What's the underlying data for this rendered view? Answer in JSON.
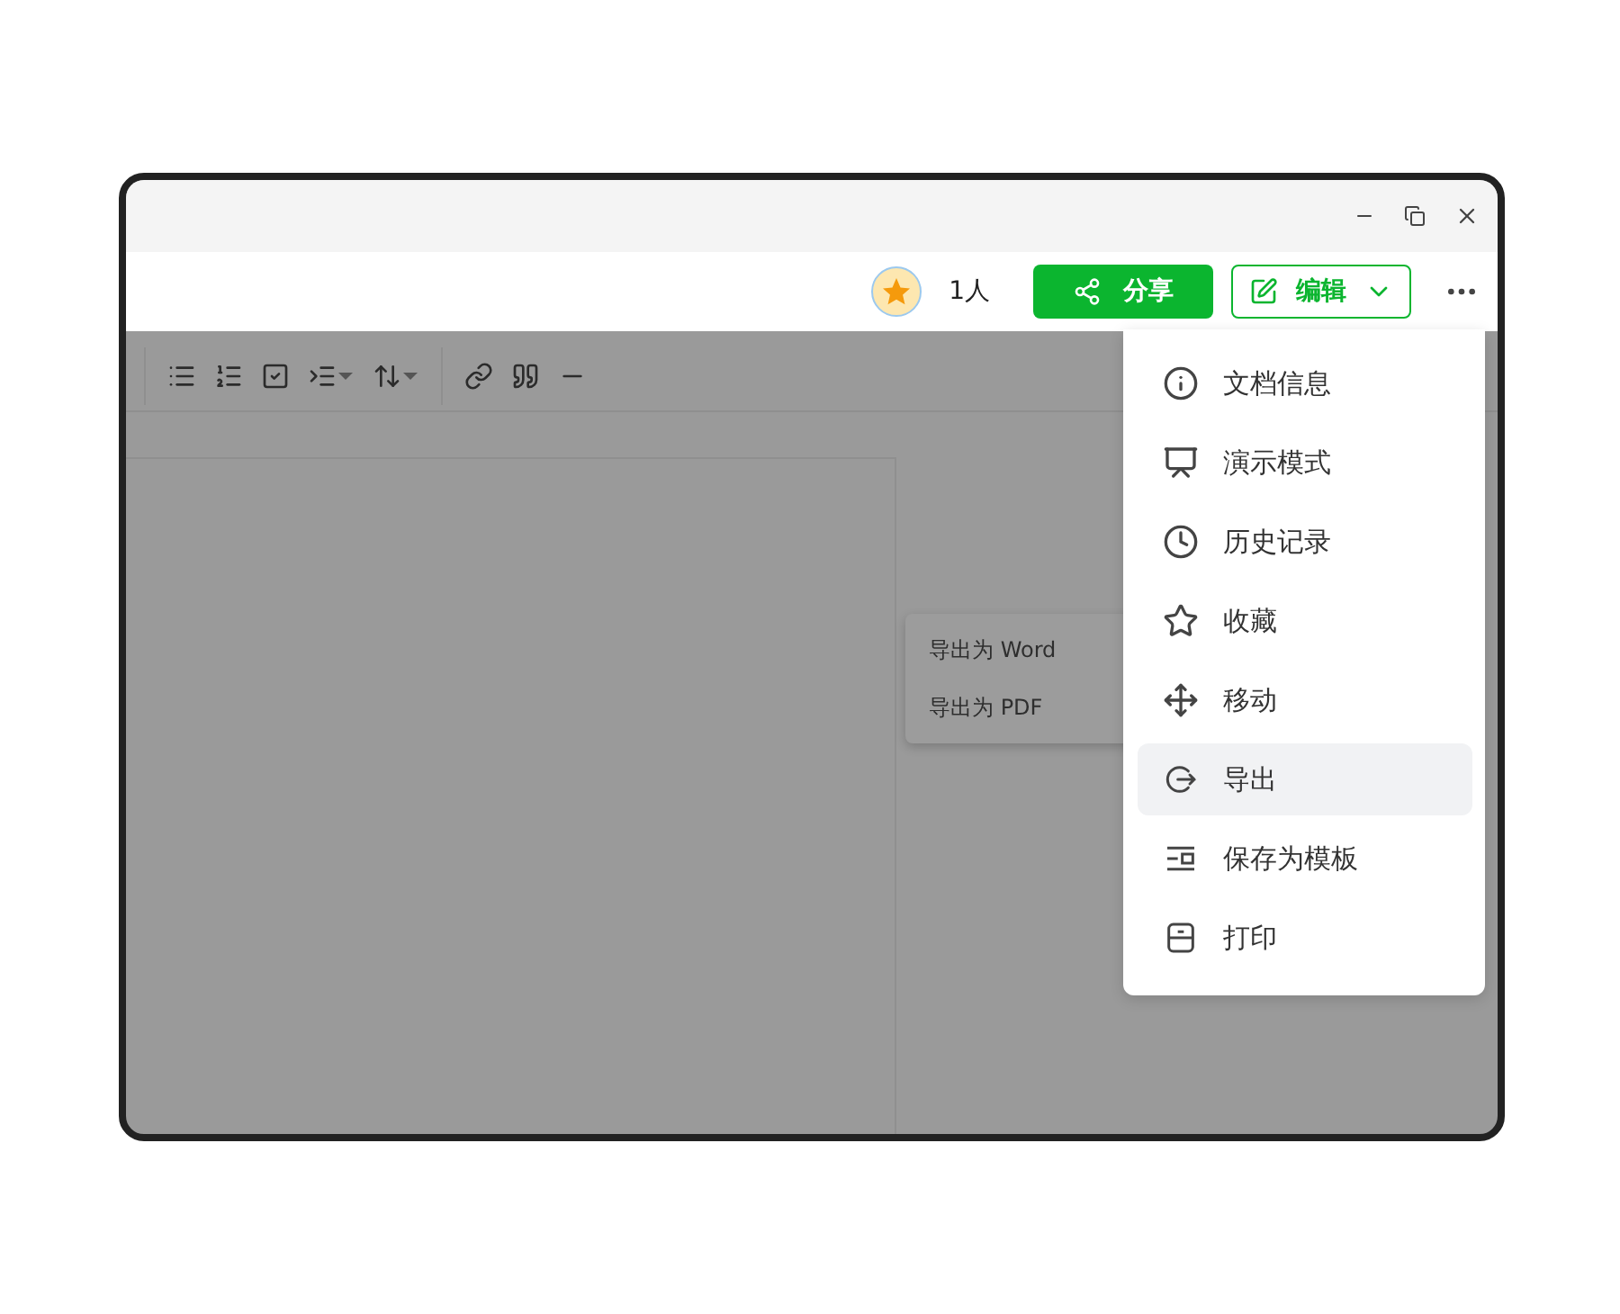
{
  "header": {
    "collaborators": "1人",
    "share_button": "分享",
    "edit_button": "编辑"
  },
  "more_menu": {
    "items": [
      {
        "label": "文档信息",
        "selected": false
      },
      {
        "label": "演示模式",
        "selected": false
      },
      {
        "label": "历史记录",
        "selected": false
      },
      {
        "label": "收藏",
        "selected": false
      },
      {
        "label": "移动",
        "selected": false
      },
      {
        "label": "导出",
        "selected": true
      },
      {
        "label": "保存为模板",
        "selected": false
      },
      {
        "label": "打印",
        "selected": false
      }
    ]
  },
  "export_submenu": {
    "items": [
      "导出为 Word",
      "导出为 PDF"
    ]
  }
}
